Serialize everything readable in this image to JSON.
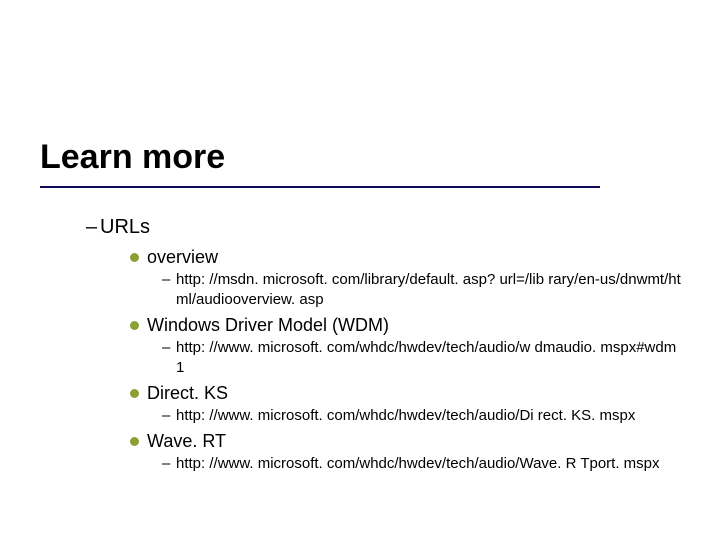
{
  "slide": {
    "title": "Learn more",
    "level1": {
      "label": "URLs",
      "items": [
        {
          "label": "overview",
          "url": "http: //msdn. microsoft. com/library/default. asp? url=/lib rary/en-us/dnwmt/html/audiooverview. asp"
        },
        {
          "label": "Windows Driver Model (WDM)",
          "url": "http: //www. microsoft. com/whdc/hwdev/tech/audio/w dmaudio. mspx#wdm 1"
        },
        {
          "label": "Direct. KS",
          "url": "http: //www. microsoft. com/whdc/hwdev/tech/audio/Di rect. KS. mspx"
        },
        {
          "label": "Wave. RT",
          "url": "http: //www. microsoft. com/whdc/hwdev/tech/audio/Wave. R Tport. mspx"
        }
      ]
    }
  }
}
